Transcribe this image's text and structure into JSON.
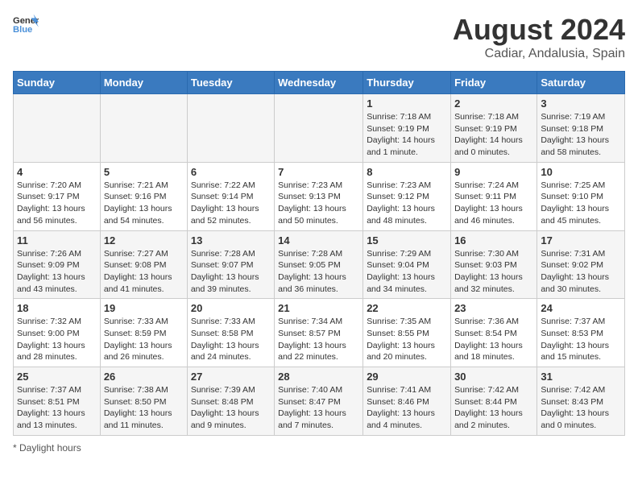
{
  "header": {
    "logo_general": "General",
    "logo_blue": "Blue",
    "month_title": "August 2024",
    "location": "Cadiar, Andalusia, Spain"
  },
  "days_of_week": [
    "Sunday",
    "Monday",
    "Tuesday",
    "Wednesday",
    "Thursday",
    "Friday",
    "Saturday"
  ],
  "weeks": [
    [
      {
        "day": "",
        "sunrise": "",
        "sunset": "",
        "daylight": ""
      },
      {
        "day": "",
        "sunrise": "",
        "sunset": "",
        "daylight": ""
      },
      {
        "day": "",
        "sunrise": "",
        "sunset": "",
        "daylight": ""
      },
      {
        "day": "",
        "sunrise": "",
        "sunset": "",
        "daylight": ""
      },
      {
        "day": "1",
        "sunrise": "Sunrise: 7:18 AM",
        "sunset": "Sunset: 9:19 PM",
        "daylight": "Daylight: 14 hours and 1 minute."
      },
      {
        "day": "2",
        "sunrise": "Sunrise: 7:18 AM",
        "sunset": "Sunset: 9:19 PM",
        "daylight": "Daylight: 14 hours and 0 minutes."
      },
      {
        "day": "3",
        "sunrise": "Sunrise: 7:19 AM",
        "sunset": "Sunset: 9:18 PM",
        "daylight": "Daylight: 13 hours and 58 minutes."
      }
    ],
    [
      {
        "day": "4",
        "sunrise": "Sunrise: 7:20 AM",
        "sunset": "Sunset: 9:17 PM",
        "daylight": "Daylight: 13 hours and 56 minutes."
      },
      {
        "day": "5",
        "sunrise": "Sunrise: 7:21 AM",
        "sunset": "Sunset: 9:16 PM",
        "daylight": "Daylight: 13 hours and 54 minutes."
      },
      {
        "day": "6",
        "sunrise": "Sunrise: 7:22 AM",
        "sunset": "Sunset: 9:14 PM",
        "daylight": "Daylight: 13 hours and 52 minutes."
      },
      {
        "day": "7",
        "sunrise": "Sunrise: 7:23 AM",
        "sunset": "Sunset: 9:13 PM",
        "daylight": "Daylight: 13 hours and 50 minutes."
      },
      {
        "day": "8",
        "sunrise": "Sunrise: 7:23 AM",
        "sunset": "Sunset: 9:12 PM",
        "daylight": "Daylight: 13 hours and 48 minutes."
      },
      {
        "day": "9",
        "sunrise": "Sunrise: 7:24 AM",
        "sunset": "Sunset: 9:11 PM",
        "daylight": "Daylight: 13 hours and 46 minutes."
      },
      {
        "day": "10",
        "sunrise": "Sunrise: 7:25 AM",
        "sunset": "Sunset: 9:10 PM",
        "daylight": "Daylight: 13 hours and 45 minutes."
      }
    ],
    [
      {
        "day": "11",
        "sunrise": "Sunrise: 7:26 AM",
        "sunset": "Sunset: 9:09 PM",
        "daylight": "Daylight: 13 hours and 43 minutes."
      },
      {
        "day": "12",
        "sunrise": "Sunrise: 7:27 AM",
        "sunset": "Sunset: 9:08 PM",
        "daylight": "Daylight: 13 hours and 41 minutes."
      },
      {
        "day": "13",
        "sunrise": "Sunrise: 7:28 AM",
        "sunset": "Sunset: 9:07 PM",
        "daylight": "Daylight: 13 hours and 39 minutes."
      },
      {
        "day": "14",
        "sunrise": "Sunrise: 7:28 AM",
        "sunset": "Sunset: 9:05 PM",
        "daylight": "Daylight: 13 hours and 36 minutes."
      },
      {
        "day": "15",
        "sunrise": "Sunrise: 7:29 AM",
        "sunset": "Sunset: 9:04 PM",
        "daylight": "Daylight: 13 hours and 34 minutes."
      },
      {
        "day": "16",
        "sunrise": "Sunrise: 7:30 AM",
        "sunset": "Sunset: 9:03 PM",
        "daylight": "Daylight: 13 hours and 32 minutes."
      },
      {
        "day": "17",
        "sunrise": "Sunrise: 7:31 AM",
        "sunset": "Sunset: 9:02 PM",
        "daylight": "Daylight: 13 hours and 30 minutes."
      }
    ],
    [
      {
        "day": "18",
        "sunrise": "Sunrise: 7:32 AM",
        "sunset": "Sunset: 9:00 PM",
        "daylight": "Daylight: 13 hours and 28 minutes."
      },
      {
        "day": "19",
        "sunrise": "Sunrise: 7:33 AM",
        "sunset": "Sunset: 8:59 PM",
        "daylight": "Daylight: 13 hours and 26 minutes."
      },
      {
        "day": "20",
        "sunrise": "Sunrise: 7:33 AM",
        "sunset": "Sunset: 8:58 PM",
        "daylight": "Daylight: 13 hours and 24 minutes."
      },
      {
        "day": "21",
        "sunrise": "Sunrise: 7:34 AM",
        "sunset": "Sunset: 8:57 PM",
        "daylight": "Daylight: 13 hours and 22 minutes."
      },
      {
        "day": "22",
        "sunrise": "Sunrise: 7:35 AM",
        "sunset": "Sunset: 8:55 PM",
        "daylight": "Daylight: 13 hours and 20 minutes."
      },
      {
        "day": "23",
        "sunrise": "Sunrise: 7:36 AM",
        "sunset": "Sunset: 8:54 PM",
        "daylight": "Daylight: 13 hours and 18 minutes."
      },
      {
        "day": "24",
        "sunrise": "Sunrise: 7:37 AM",
        "sunset": "Sunset: 8:53 PM",
        "daylight": "Daylight: 13 hours and 15 minutes."
      }
    ],
    [
      {
        "day": "25",
        "sunrise": "Sunrise: 7:37 AM",
        "sunset": "Sunset: 8:51 PM",
        "daylight": "Daylight: 13 hours and 13 minutes."
      },
      {
        "day": "26",
        "sunrise": "Sunrise: 7:38 AM",
        "sunset": "Sunset: 8:50 PM",
        "daylight": "Daylight: 13 hours and 11 minutes."
      },
      {
        "day": "27",
        "sunrise": "Sunrise: 7:39 AM",
        "sunset": "Sunset: 8:48 PM",
        "daylight": "Daylight: 13 hours and 9 minutes."
      },
      {
        "day": "28",
        "sunrise": "Sunrise: 7:40 AM",
        "sunset": "Sunset: 8:47 PM",
        "daylight": "Daylight: 13 hours and 7 minutes."
      },
      {
        "day": "29",
        "sunrise": "Sunrise: 7:41 AM",
        "sunset": "Sunset: 8:46 PM",
        "daylight": "Daylight: 13 hours and 4 minutes."
      },
      {
        "day": "30",
        "sunrise": "Sunrise: 7:42 AM",
        "sunset": "Sunset: 8:44 PM",
        "daylight": "Daylight: 13 hours and 2 minutes."
      },
      {
        "day": "31",
        "sunrise": "Sunrise: 7:42 AM",
        "sunset": "Sunset: 8:43 PM",
        "daylight": "Daylight: 13 hours and 0 minutes."
      }
    ]
  ],
  "footer": {
    "note": "Daylight hours"
  }
}
